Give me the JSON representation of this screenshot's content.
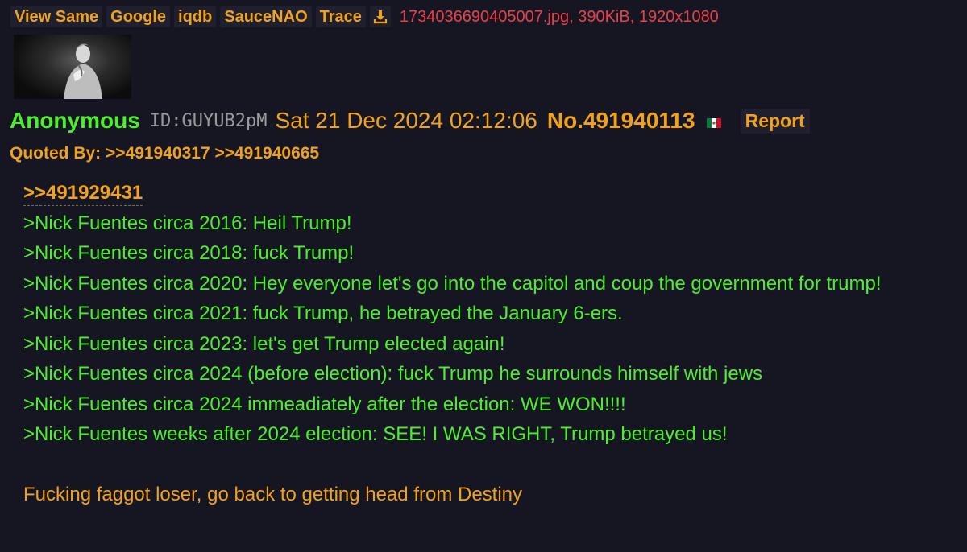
{
  "toolbar": {
    "buttons": [
      "View Same",
      "Google",
      "iqdb",
      "SauceNAO",
      "Trace"
    ],
    "download_icon": "download-icon",
    "file_info": "1734036690405007.jpg, 390KiB, 1920x1080"
  },
  "post": {
    "name": "Anonymous",
    "poster_id": "ID:GUYUB2pM",
    "date": "Sat 21 Dec 2024 02:12:06",
    "post_number": "No.491940113",
    "flag_icon": "mexico-flag-icon",
    "report_label": "Report",
    "quoted_by": "Quoted By: >>491940317 >>491940665",
    "quote_link": ">>491929431",
    "greentext_lines": [
      ">Nick Fuentes circa 2016: Heil Trump!",
      ">Nick Fuentes circa 2018: fuck Trump!",
      ">Nick Fuentes circa 2020: Hey everyone let's go into the capitol and coup the government for trump!",
      ">Nick Fuentes circa 2021: fuck Trump, he betrayed the January 6-ers.",
      ">Nick Fuentes circa 2023: let's get Trump elected again!",
      ">Nick Fuentes circa 2024 (before election): fuck Trump he surrounds himself with jews",
      ">Nick Fuentes circa 2024 immeadiately after the election: WE WON!!!!",
      ">Nick Fuentes weeks after 2024 election: SEE! I WAS RIGHT, Trump betrayed us!"
    ],
    "closing_line": "Fucking faggot loser, go back to getting head from Destiny"
  },
  "colors": {
    "background": "#161622",
    "accent": "#f0a21e",
    "greentext": "#4bef2e",
    "file_info": "#e8414a",
    "poster_id": "#9a9a9a"
  }
}
